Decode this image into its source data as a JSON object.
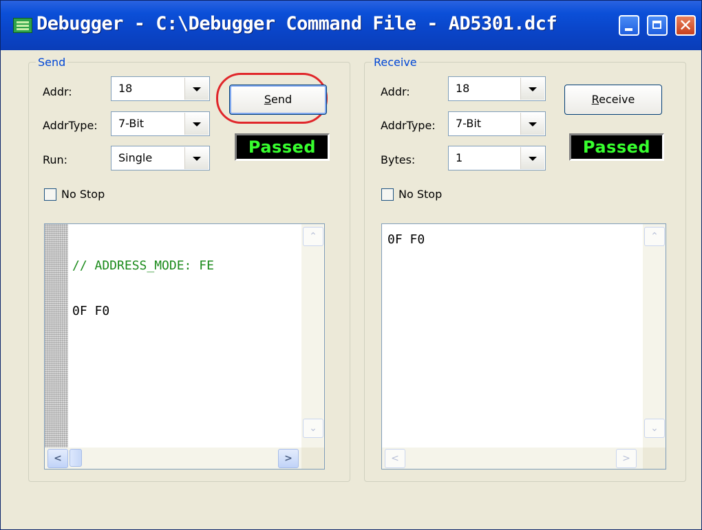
{
  "window": {
    "title": "Debugger - C:\\Debugger Command File - AD5301.dcf",
    "title_icon": "chip-icon",
    "controls": {
      "minimize": "minimize-icon",
      "maximize": "maximize-icon",
      "close": "✕"
    }
  },
  "send": {
    "legend": "Send",
    "addr_label": "Addr:",
    "addr_value": "18",
    "addrtype_label": "AddrType:",
    "addrtype_value": "7-Bit",
    "run_label": "Run:",
    "run_value": "Single",
    "button_label": "Send",
    "button_accel": "S",
    "button_rest": "end",
    "status": "Passed",
    "nostop_label": "No Stop",
    "nostop_checked": false,
    "editor_lines": [
      {
        "text": "// ADDRESS_MODE: FE",
        "kind": "comment"
      },
      {
        "text": "0F F0",
        "kind": "data"
      }
    ],
    "scroll_up": "⌃",
    "scroll_down": "⌄",
    "scroll_left": "<",
    "scroll_right": ">"
  },
  "receive": {
    "legend": "Receive",
    "addr_label": "Addr:",
    "addr_value": "18",
    "addrtype_label": "AddrType:",
    "addrtype_value": "7-Bit",
    "bytes_label": "Bytes:",
    "bytes_value": "1",
    "button_label": "Receive",
    "button_accel": "R",
    "button_rest": "eceive",
    "status": "Passed",
    "nostop_label": "No Stop",
    "nostop_checked": false,
    "output_text": "0F F0",
    "scroll_up": "⌃",
    "scroll_down": "⌄",
    "scroll_left": "<",
    "scroll_right": ">"
  },
  "colors": {
    "titlebar": "#0a45c9",
    "status_text": "#37ff2e",
    "status_bg": "#000000",
    "comment": "#1a8a1a",
    "highlight_ring": "#e0262a",
    "legend": "#0046d5"
  }
}
